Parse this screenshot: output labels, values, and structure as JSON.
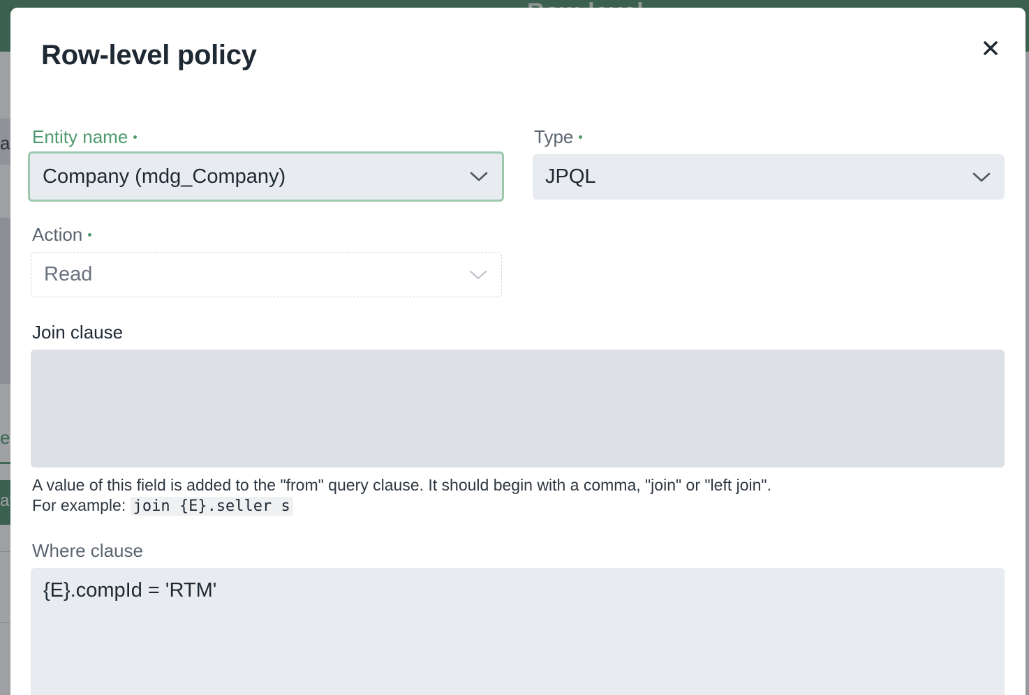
{
  "background": {
    "header_title": "Row-level",
    "left_letters": [
      "a",
      "e",
      "at"
    ]
  },
  "modal": {
    "title": "Row-level policy",
    "close_icon": "close-icon"
  },
  "fields": {
    "entity_name": {
      "label": "Entity name",
      "value": "Company (mdg_Company)"
    },
    "type": {
      "label": "Type",
      "value": "JPQL"
    },
    "action": {
      "label": "Action",
      "value": "Read"
    },
    "join_clause": {
      "label": "Join clause",
      "value": "",
      "help_line1": "A value of this field is added to the \"from\" query clause. It should begin with a comma, \"join\" or \"left join\".",
      "help_example_prefix": "For example:",
      "help_example_code": "join {E}.seller s"
    },
    "where_clause": {
      "label": "Where clause",
      "value": "{E}.compId = 'RTM'"
    }
  },
  "colors": {
    "accent": "#4f9a6e",
    "header_bg": "#4e8b69",
    "field_bg": "#e8ebef",
    "disabled_field_bg": "#dde0e4"
  }
}
